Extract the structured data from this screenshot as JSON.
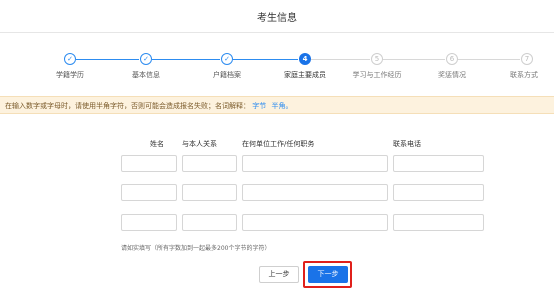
{
  "header": {
    "title": "考生信息"
  },
  "stepper": {
    "steps": [
      {
        "num": "1",
        "label": "学籍学历",
        "state": "done"
      },
      {
        "num": "2",
        "label": "基本信息",
        "state": "done"
      },
      {
        "num": "3",
        "label": "户籍档案",
        "state": "done"
      },
      {
        "num": "4",
        "label": "家庭主要成员",
        "state": "active"
      },
      {
        "num": "5",
        "label": "学习与工作经历",
        "state": "todo"
      },
      {
        "num": "6",
        "label": "奖惩情况",
        "state": "todo"
      },
      {
        "num": "7",
        "label": "联系方式",
        "state": "todo"
      }
    ],
    "done_mark": "✓"
  },
  "notice": {
    "text": "在输入数字或字母时，请使用半角字符，否则可能会造成报名失败；名词解释：",
    "link_byte": "字节",
    "link_half": "半角。"
  },
  "form": {
    "columns": [
      "姓名",
      "与本人关系",
      "在何单位工作/任何职务",
      "联系电话"
    ],
    "rows": 3,
    "note": "请如实填写（所有字数加到一起最多200个字节的字符）"
  },
  "buttons": {
    "prev": "上一步",
    "next": "下一步"
  },
  "colors": {
    "accent": "#1a73e8",
    "highlight": "#e0201b",
    "notice_bg": "#fdf2de"
  }
}
